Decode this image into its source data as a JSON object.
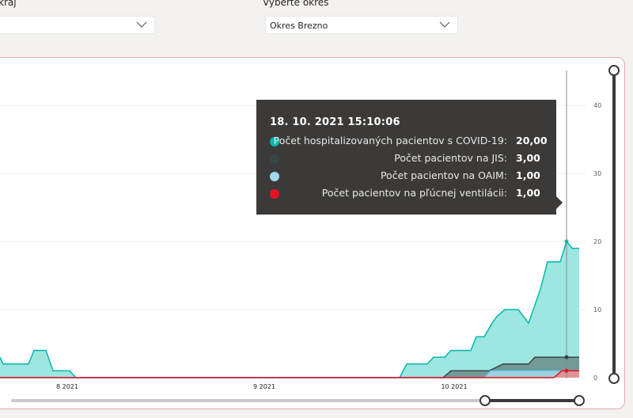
{
  "filters": {
    "region_label": "kraj",
    "region_value": "",
    "district_label": "Vyberte okres",
    "district_value": "Okres Brezno"
  },
  "chart_data": {
    "type": "area",
    "x_ticks": [
      "8 2021",
      "9 2021",
      "10 2021"
    ],
    "y_ticks": [
      "0",
      "10",
      "20",
      "30",
      "40"
    ],
    "ylim": [
      0,
      44
    ],
    "grid": true,
    "series": [
      {
        "name": "Počet hospitalizovaných pacientov s COVID-19",
        "color": "#01b8aa",
        "fill": "#8de2da",
        "points": [
          [
            0,
            3
          ],
          [
            4,
            2
          ],
          [
            36,
            2
          ],
          [
            43,
            4
          ],
          [
            58,
            4
          ],
          [
            67,
            1
          ],
          [
            88,
            1
          ],
          [
            96,
            0
          ],
          [
            505,
            0
          ],
          [
            514,
            2
          ],
          [
            540,
            2
          ],
          [
            548,
            3
          ],
          [
            562,
            3
          ],
          [
            570,
            4
          ],
          [
            595,
            4
          ],
          [
            602,
            6
          ],
          [
            612,
            6
          ],
          [
            622,
            8
          ],
          [
            628,
            9
          ],
          [
            638,
            10
          ],
          [
            655,
            10
          ],
          [
            668,
            8
          ],
          [
            683,
            13
          ],
          [
            692,
            17
          ],
          [
            708,
            17
          ],
          [
            716,
            20
          ],
          [
            723,
            19
          ],
          [
            732,
            19
          ]
        ]
      },
      {
        "name": "Počet pacientov na JIS",
        "color": "#374649",
        "fill": "#6b8c8a",
        "points": [
          [
            0,
            0
          ],
          [
            560,
            0
          ],
          [
            570,
            1
          ],
          [
            612,
            1
          ],
          [
            618,
            1
          ],
          [
            636,
            2
          ],
          [
            668,
            2
          ],
          [
            676,
            3
          ],
          [
            732,
            3
          ]
        ]
      },
      {
        "name": "Počet pacientov na OAIM",
        "color": "#5fc8e8",
        "fill": "#a7dbe8",
        "points": [
          [
            0,
            0
          ],
          [
            612,
            0
          ],
          [
            620,
            1
          ],
          [
            732,
            1
          ]
        ]
      },
      {
        "name": "Počet pacientov na pľúcnej ventilácii",
        "color": "#e81123",
        "fill": "#e88a8a",
        "points": [
          [
            0,
            0
          ],
          [
            700,
            0
          ],
          [
            710,
            1
          ],
          [
            732,
            1
          ]
        ]
      }
    ]
  },
  "tooltip": {
    "datetime": "18. 10. 2021 15:10:06",
    "rows": [
      {
        "label": "Počet hospitalizovaných pacientov s COVID-19:",
        "value": "20,00",
        "color": "#01b8aa"
      },
      {
        "label": "Počet pacientov na JIS:",
        "value": "3,00",
        "color": "#374649"
      },
      {
        "label": "Počet pacientov na OAIM:",
        "value": "1,00",
        "color": "#a0d9f0"
      },
      {
        "label": "Počet pacientov na pľúcnej ventilácii:",
        "value": "1,00",
        "color": "#e81123"
      }
    ]
  },
  "colors": {
    "accent": "#01b8aa",
    "border": "#e8aaa8",
    "tooltip_bg": "#3b3a39"
  }
}
